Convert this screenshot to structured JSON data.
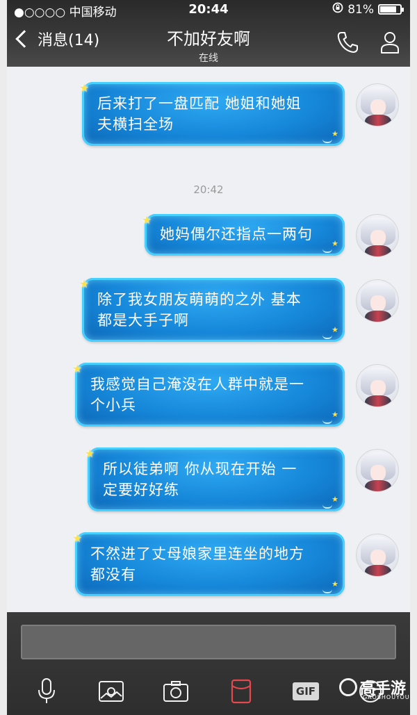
{
  "status_bar": {
    "carrier": "●○○○○ 中国移动",
    "time": "20:44",
    "battery": "81%",
    "battery_level": 0.81,
    "icons": [
      "wifi-icon",
      "rotation-lock-icon",
      "battery-icon"
    ]
  },
  "nav": {
    "back_label": "消息(14)",
    "title": "不加好友啊",
    "subtitle": "在线",
    "icons": [
      "chevron-left-icon",
      "phone-icon",
      "profile-icon"
    ]
  },
  "chat": {
    "timestamp": "20:42",
    "messages": [
      {
        "line1": "后来打了一盘匹配  她姐和她姐",
        "line2": "夫横扫全场"
      },
      {
        "line1": "她妈偶尔还指点一两句",
        "line2": ""
      },
      {
        "line1": "除了我女朋友萌萌的之外  基本",
        "line2": "都是大手子啊"
      },
      {
        "line1": "我感觉自己淹没在人群中就是一",
        "line2": "个小兵"
      },
      {
        "line1": "所以徒弟啊  你从现在开始  一",
        "line2": "定要好好练"
      },
      {
        "line1": "不然进了丈母娘家里连坐的地方",
        "line2": "都没有"
      }
    ]
  },
  "toolbar": {
    "gif_label": "GIF",
    "icons": [
      "microphone-icon",
      "image-icon",
      "camera-icon",
      "red-packet-icon",
      "gif-icon",
      "emoji-icon"
    ]
  },
  "watermark": {
    "text": "高手游",
    "sub": "GAOSHOUYOU.COM"
  },
  "colors": {
    "bubble": "#1687d9",
    "bubble_glow": "#45d0ff",
    "header": "#333333"
  }
}
